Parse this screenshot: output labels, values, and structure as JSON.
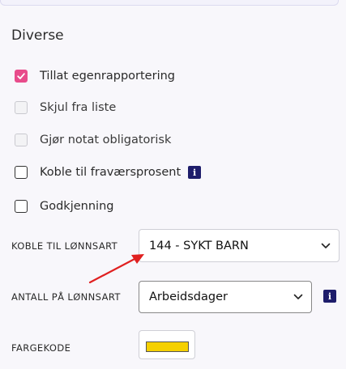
{
  "section": {
    "title": "Diverse"
  },
  "checkboxes": [
    {
      "label": "Tillat egenrapportering",
      "checked": true
    },
    {
      "label": "Skjul fra liste",
      "checked": false,
      "disabled": true
    },
    {
      "label": "Gjør notat obligatorisk",
      "checked": false,
      "disabled": true
    },
    {
      "label": "Koble til fraværsprosent",
      "checked": false,
      "info_icon": "info-icon"
    },
    {
      "label": "Godkjenning",
      "checked": false
    }
  ],
  "fields": {
    "lonnsart": {
      "label": "KOBLE TIL LØNNSART",
      "value": "144 - SYKT BARN"
    },
    "antall": {
      "label": "ANTALL PÅ LØNNSART",
      "value": "Arbeidsdager",
      "info_icon": "info-icon"
    },
    "fargekode": {
      "label": "FARGEKODE",
      "color": "#f5d000"
    }
  },
  "colors": {
    "accent": "#e84c8b",
    "info": "#1e1d6b",
    "annotation_arrow": "#e02020"
  }
}
